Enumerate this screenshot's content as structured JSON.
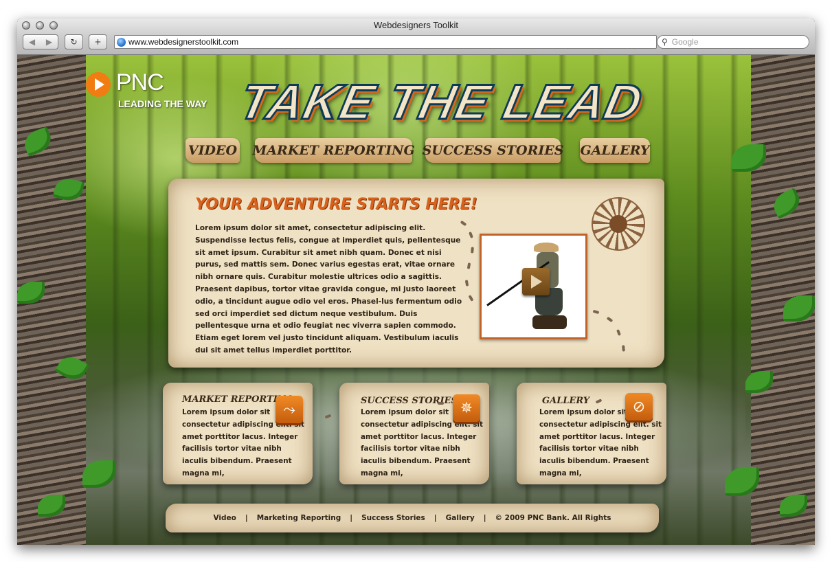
{
  "browser": {
    "window_title": "Webdesigners Toolkit",
    "url": "www.webdesignerstoolkit.com",
    "search_placeholder": "Google",
    "reload_glyph": "↻",
    "add_glyph": "+",
    "back_glyph": "◀",
    "forward_glyph": "▶"
  },
  "brand": {
    "name": "PNC",
    "tagline": "LEADING THE WAY",
    "accent": "#f07c12"
  },
  "headline": "TAKE THE LEAD",
  "nav": {
    "items": [
      "VIDEO",
      "MARKET REPORTING",
      "SUCCESS STORIES",
      "GALLERY"
    ]
  },
  "main": {
    "title": "YOUR ADVENTURE STARTS HERE!",
    "body": "Lorem ipsum dolor sit amet, consectetur adipiscing elit. Suspendisse lectus felis, congue at imperdiet quis, pellentesque sit amet ipsum. Curabitur sit amet nibh quam. Donec et nisi purus, sed mattis sem. Donec varius egestas erat, vitae ornare nibh ornare quis. Curabitur molestie ultrices odio a sagittis. Praesent dapibus, tortor vitae gravida congue, mi justo laoreet odio, a tincidunt augue odio vel eros. Phasel-lus fermentum odio sed orci imperdiet sed dictum neque vestibulum. Duis pellentesque urna et odio feugiat nec viverra sapien commodo. Etiam eget lorem vel justo tincidunt aliquam. Vestibulum iaculis dui sit amet tellus imperdiet porttitor.",
    "video_icon": "play-icon"
  },
  "cards": [
    {
      "title": "MARKET REPORTING",
      "body": "Lorem ipsum dolor sit consectetur adipiscing elit. sit amet porttitor lacus. Integer facilisis tortor vitae nibh iaculis bibendum. Praesent magna mi,",
      "icon": "map-route-icon",
      "glyph": "⤳"
    },
    {
      "title": "SUCCESS STORIES",
      "body": "Lorem ipsum dolor sit consectetur adipiscing elit. sit amet porttitor lacus. Integer facilisis tortor vitae nibh iaculis bibendum. Praesent magna mi,",
      "icon": "compass-rose-icon",
      "glyph": "✵"
    },
    {
      "title": "GALLERY",
      "body": "Lorem ipsum dolor sit consectetur adipiscing elit. sit amet porttitor lacus. Integer facilisis tortor vitae nibh iaculis bibendum. Praesent magna mi,",
      "icon": "compass-icon",
      "glyph": "⊘"
    }
  ],
  "footer": {
    "links": [
      "Video",
      "Marketing Reporting",
      "Success Stories",
      "Gallery"
    ],
    "separator": "|",
    "copyright": "© 2009 PNC Bank. All Rights"
  }
}
